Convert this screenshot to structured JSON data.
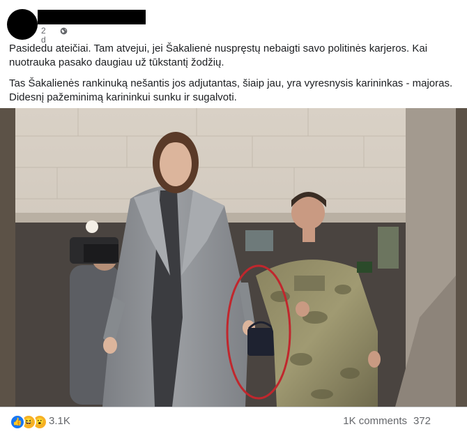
{
  "post": {
    "author_name": "",
    "time": "2 d",
    "privacy_icon": "globe-icon",
    "paragraphs": [
      "Pasidedu ateičiai. Tam atvejui, jei Šakalienė nuspręstų nebaigti savo politinės karjeros. Kai nuotrauka pasako daugiau už tūkstantį žodžių.",
      "Tas Šakalienės rankinuką nešantis jos adjutantas, šiaip jau, yra vyresnysis karininkas - majoras. Didesnį pažeminimą karininkui sunku ir sugalvoti."
    ]
  },
  "photo": {
    "annotation_color": "#c0272d"
  },
  "footer": {
    "reaction_icons": [
      "like-icon",
      "haha-icon",
      "wow-icon"
    ],
    "reaction_count": "3.1K",
    "comments": "1K comments",
    "shares": "372"
  }
}
